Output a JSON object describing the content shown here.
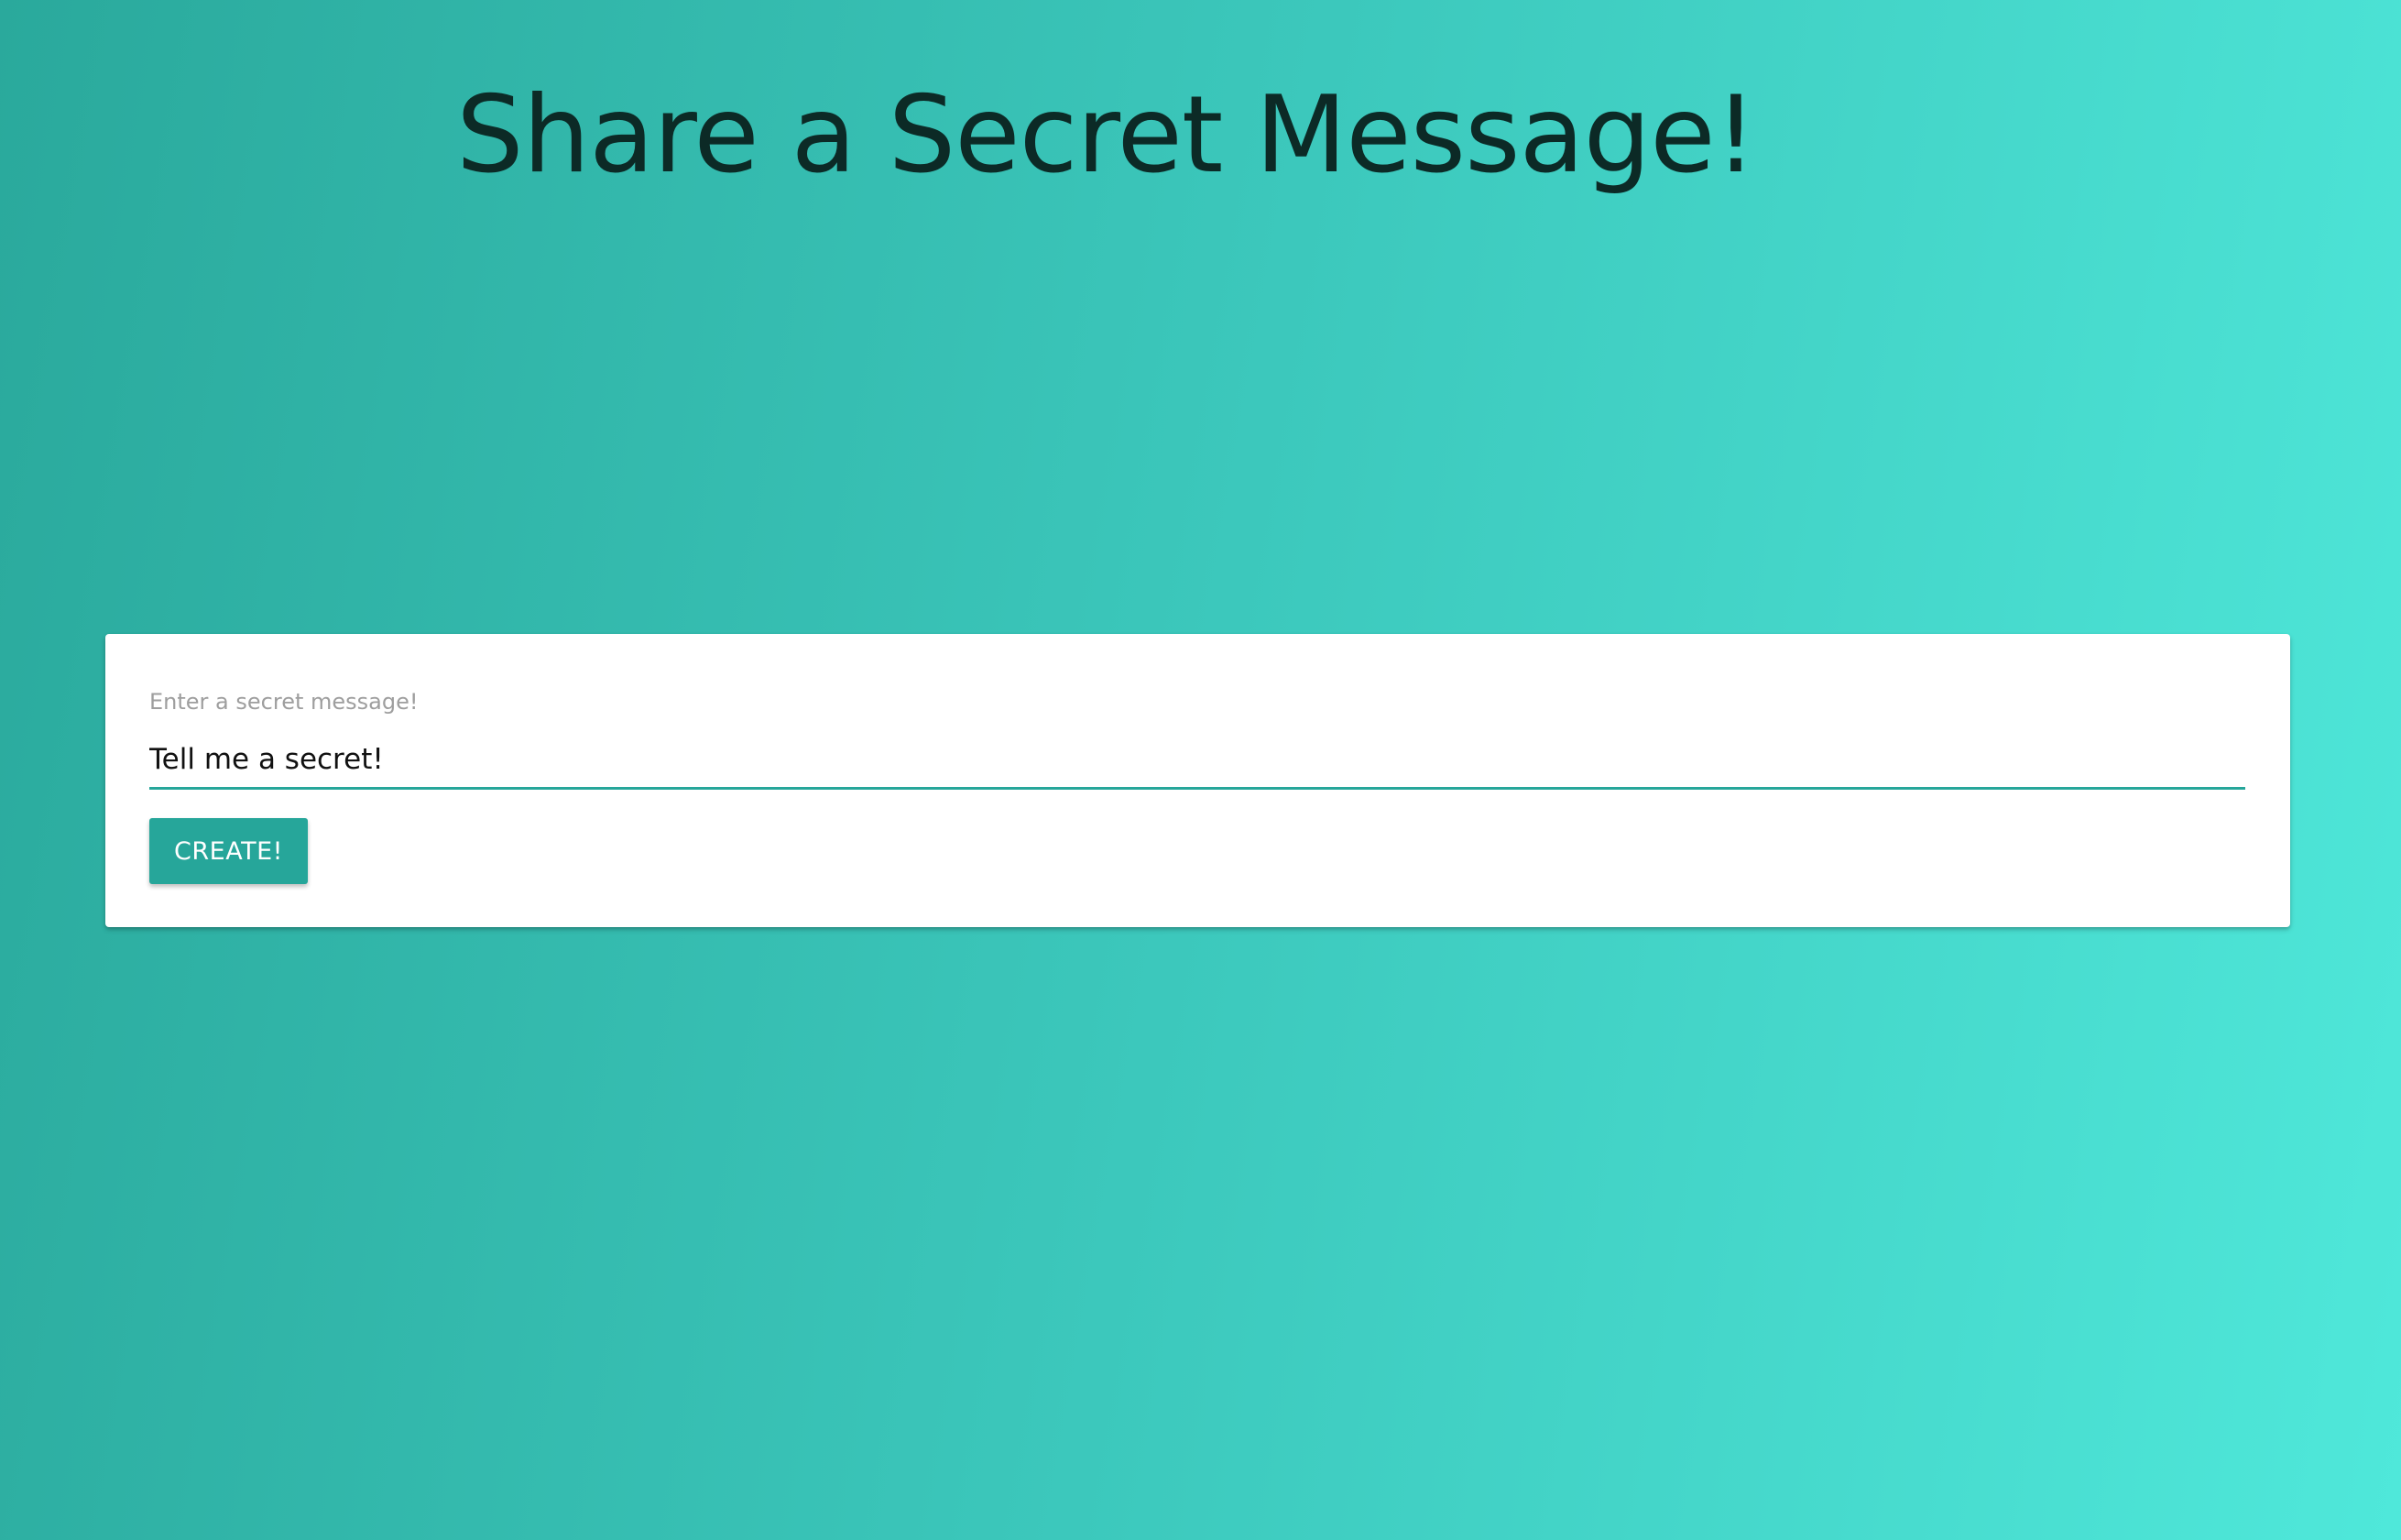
{
  "header": {
    "title": "Share a Secret Message!"
  },
  "form": {
    "label": "Enter a secret message!",
    "input_value": "Tell me a secret!",
    "create_label": "CREATE!"
  },
  "colors": {
    "accent": "#26a69a",
    "background_start": "#2aa99c",
    "background_end": "#4fe8da",
    "title_text": "#0c2a26"
  }
}
